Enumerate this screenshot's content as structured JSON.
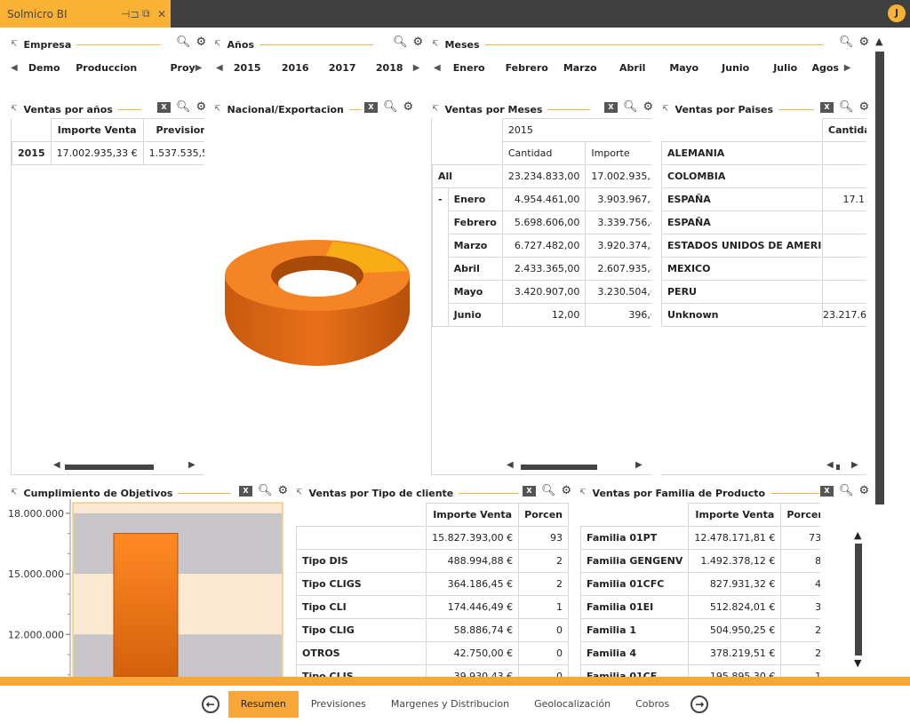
{
  "app": {
    "tab_title": "Solmicro BI",
    "avatar_initial": "J",
    "accent": "#f9b233"
  },
  "filters": {
    "empresa": {
      "title": "Empresa",
      "items": [
        "Demo",
        "Produccion",
        "Proy"
      ]
    },
    "anos": {
      "title": "Años",
      "items": [
        "2015",
        "2016",
        "2017",
        "2018"
      ]
    },
    "meses": {
      "title": "Meses",
      "items": [
        "Enero",
        "Febrero",
        "Marzo",
        "Abril",
        "Mayo",
        "Junio",
        "Julio",
        "Agos"
      ]
    }
  },
  "ventas_anos": {
    "title": "Ventas por años",
    "headers": [
      "Importe Venta",
      "Prevision",
      "I"
    ],
    "rows": [
      [
        "2015",
        "17.002.935,33 €",
        "1.537.535,57"
      ]
    ]
  },
  "nacional": {
    "title": "Nacional/Exportacion",
    "chart_type": "donut",
    "colors": [
      "#f07d1a",
      "#f9ad14"
    ]
  },
  "ventas_meses": {
    "title": "Ventas por Meses",
    "year": "2015",
    "headers": [
      "Cantidad",
      "Importe"
    ],
    "all_label": "All",
    "all": [
      "23.234.833,00",
      "17.002.935,33 €"
    ],
    "collapse": "-",
    "rows": [
      [
        "Enero",
        "4.954.461,00",
        "3.903.967,58 €"
      ],
      [
        "Febrero",
        "5.698.606,00",
        "3.339.756,40 €"
      ],
      [
        "Marzo",
        "6.727.482,00",
        "3.920.374,21 €"
      ],
      [
        "Abril",
        "2.433.365,00",
        "2.607.935,88 €"
      ],
      [
        "Mayo",
        "3.420.907,00",
        "3.230.504,64 €"
      ],
      [
        "Junio",
        "12,00",
        "396,62 €"
      ]
    ]
  },
  "ventas_paises": {
    "title": "Ventas por Paises",
    "header": "Cantida",
    "rows": [
      [
        "ALEMANIA",
        ""
      ],
      [
        "COLOMBIA",
        ""
      ],
      [
        "ESPAÑA",
        "17.1"
      ],
      [
        "ESPAÑA",
        ""
      ],
      [
        "ESTADOS UNIDOS DE AMERICA",
        ""
      ],
      [
        "MEXICO",
        ""
      ],
      [
        "PERU",
        ""
      ],
      [
        "Unknown",
        "23.217.6"
      ]
    ]
  },
  "cumplimiento": {
    "title": "Cumplimiento de Objetivos"
  },
  "chart_data": {
    "type": "bar",
    "categories": [
      ""
    ],
    "values": [
      17002935.33
    ],
    "yticks": [
      "18.000.000",
      "15.000.000",
      "12.000.000"
    ],
    "ylim": [
      9900000,
      18700000
    ],
    "bar_color": "#f07d1a",
    "band_colors": [
      "#c8c6c8",
      "#fde9d3"
    ]
  },
  "tipo_cliente": {
    "title": "Ventas por Tipo de cliente",
    "headers": [
      "Importe Venta",
      "Porcen"
    ],
    "rows": [
      [
        "",
        "15.827.393,00 €",
        "93"
      ],
      [
        "Tipo DIS",
        "488.994,88 €",
        "2"
      ],
      [
        "Tipo CLIGS",
        "364.186,45 €",
        "2"
      ],
      [
        "Tipo CLI",
        "174.446,49 €",
        "1"
      ],
      [
        "Tipo CLIG",
        "58.886,74 €",
        "0"
      ],
      [
        "OTROS",
        "42.750,00 €",
        "0"
      ],
      [
        "Tipo CLIS",
        "39.930,43 €",
        "0"
      ]
    ]
  },
  "familia": {
    "title": "Ventas por Familia de Producto",
    "headers": [
      "Importe Venta",
      "Porcentaje"
    ],
    "rows": [
      [
        "Familia 01PT",
        "12.478.171,81 €",
        "73,39%"
      ],
      [
        "Familia GENGENV",
        "1.492.378,12 €",
        "8,78%"
      ],
      [
        "Familia 01CFC",
        "827.931,32 €",
        "4,87%"
      ],
      [
        "Familia 01EI",
        "512.824,01 €",
        "3,02%"
      ],
      [
        "Familia 1",
        "504.950,25 €",
        "2,97%"
      ],
      [
        "Familia 4",
        "378.219,51 €",
        "2,22%"
      ],
      [
        "Familia 01CF",
        "195.895,30 €",
        "1,15%"
      ]
    ]
  },
  "nav": {
    "tabs": [
      "Resumen",
      "Previsiones",
      "Margenes y Distribucion",
      "Geolocalización",
      "Cobros"
    ],
    "active": "Resumen"
  }
}
